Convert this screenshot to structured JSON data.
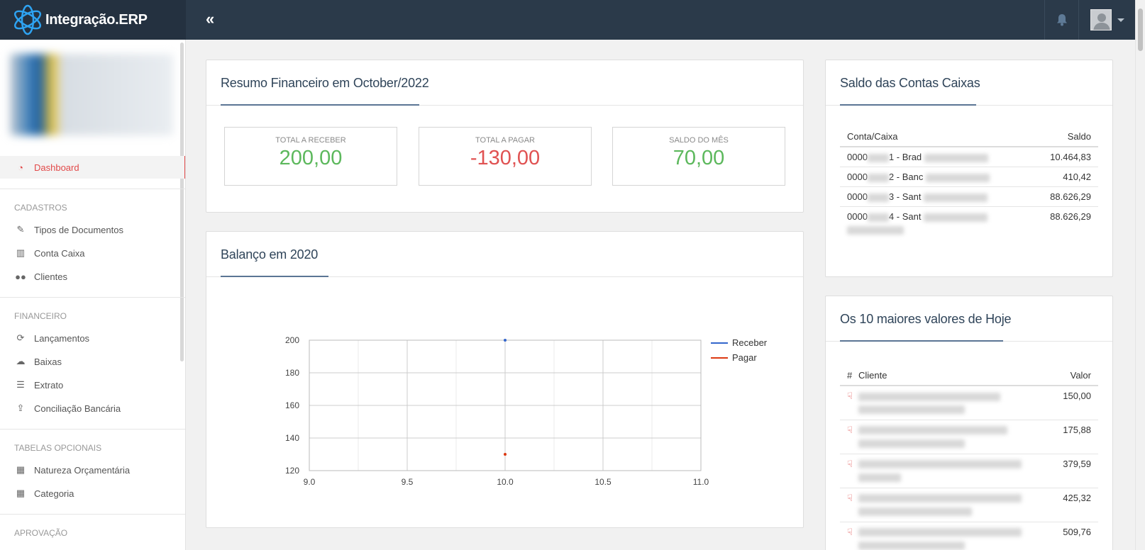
{
  "brand": {
    "name": "Integração.ERP"
  },
  "topbar": {
    "collapse_icon": "«"
  },
  "sidebar": {
    "dashboard": "Dashboard",
    "sections": [
      {
        "title": "CADASTROS",
        "items": [
          "Tipos de Documentos",
          "Conta Caixa",
          "Clientes"
        ]
      },
      {
        "title": "FINANCEIRO",
        "items": [
          "Lançamentos",
          "Baixas",
          "Extrato",
          "Conciliação Bancária"
        ]
      },
      {
        "title": "TABELAS OPCIONAIS",
        "items": [
          "Natureza Orçamentária",
          "Categoria"
        ]
      },
      {
        "title": "APROVAÇÃO",
        "items": []
      }
    ]
  },
  "resumo": {
    "title": "Resumo Financeiro em October/2022",
    "cards": [
      {
        "label": "TOTAL A RECEBER",
        "value": "200,00",
        "color": "#5cb85c"
      },
      {
        "label": "TOTAL A PAGAR",
        "value": "-130,00",
        "color": "#e05252"
      },
      {
        "label": "SALDO DO MÊS",
        "value": "70,00",
        "color": "#5cb85c"
      }
    ]
  },
  "balanco": {
    "title": "Balanço em 2020"
  },
  "chart_data": {
    "type": "line",
    "title": "",
    "xlabel": "",
    "ylabel": "",
    "xlim": [
      9.0,
      11.0
    ],
    "ylim": [
      120,
      200
    ],
    "x_ticks": [
      "9.0",
      "9.5",
      "10.0",
      "10.5",
      "11.0"
    ],
    "y_ticks": [
      "200",
      "180",
      "160",
      "140",
      "120"
    ],
    "grid": true,
    "legend_position": "right",
    "series": [
      {
        "name": "Receber",
        "color": "#3366cc",
        "points": [
          [
            10.0,
            200
          ]
        ]
      },
      {
        "name": "Pagar",
        "color": "#dc3912",
        "points": [
          [
            10.0,
            130
          ]
        ]
      }
    ]
  },
  "saldo": {
    "title": "Saldo das Contas Caixas",
    "headers": [
      "Conta/Caixa",
      "Saldo"
    ],
    "rows": [
      {
        "conta_a": "0000",
        "conta_b": "1 - Brad",
        "saldo": "10.464,83"
      },
      {
        "conta_a": "0000",
        "conta_b": "2 - Banc",
        "saldo": "410,42"
      },
      {
        "conta_a": "0000",
        "conta_b": "3 - Sant",
        "saldo": "88.626,29"
      },
      {
        "conta_a": "0000",
        "conta_b": "4 - Sant",
        "saldo": "88.626,29"
      }
    ]
  },
  "maiores": {
    "title": "Os 10 maiores valores de Hoje",
    "headers": [
      "#",
      "Cliente",
      "Valor"
    ],
    "rows": [
      {
        "valor": "150,00"
      },
      {
        "valor": "175,88"
      },
      {
        "valor": "379,59"
      },
      {
        "valor": "425,32"
      },
      {
        "valor": "509,76"
      }
    ]
  }
}
